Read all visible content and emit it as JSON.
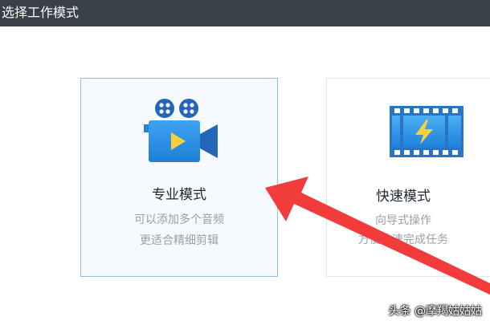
{
  "window": {
    "title": "选择工作模式"
  },
  "modes": [
    {
      "title": "专业模式",
      "desc_line1": "可以添加多个音频",
      "desc_line2": "更适合精细剪辑",
      "icon": "movie-camera-icon",
      "selected": true
    },
    {
      "title": "快速模式",
      "desc_line1": "向导式操作",
      "desc_line2": "方便快速完成任务",
      "icon": "film-strip-icon",
      "selected": false
    }
  ],
  "watermark": {
    "text": "头条 @摩羯姑姑姑"
  },
  "colors": {
    "titlebar": "#3a4048",
    "accent_blue": "#2d8fe6",
    "selected_border": "#8cc0ec",
    "annotation_arrow": "#f23b3b"
  }
}
